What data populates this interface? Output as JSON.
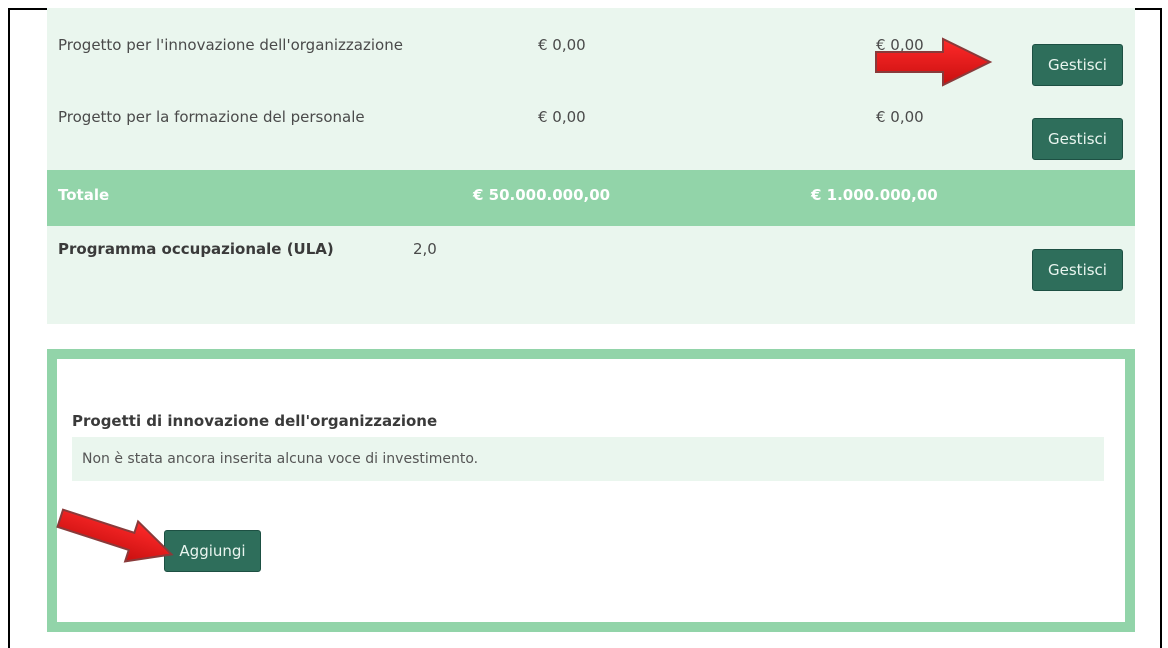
{
  "rows": [
    {
      "label": "Progetto per l'innovazione dell'organizzazione",
      "amount1": "€ 0,00",
      "amount2": "€ 0,00",
      "button": "Gestisci"
    },
    {
      "label": "Progetto per la formazione del personale",
      "amount1": "€ 0,00",
      "amount2": "€ 0,00",
      "button": "Gestisci"
    }
  ],
  "total": {
    "label": "Totale",
    "amount1": "€ 50.000.000,00",
    "amount2": "€ 1.000.000,00"
  },
  "occupational": {
    "label": "Programma occupazionale (ULA)",
    "value": "2,0",
    "button": "Gestisci"
  },
  "section": {
    "title": "Progetti di innovazione dell'organizzazione",
    "empty_message": "Non è stata ancora inserita alcuna voce di investimento.",
    "add_button": "Aggiungi"
  },
  "colors": {
    "accent_green": "#92d4a9",
    "button_green": "#2e6e5b",
    "light_green": "#eaf6ee",
    "arrow_red": "#e21e1e"
  }
}
